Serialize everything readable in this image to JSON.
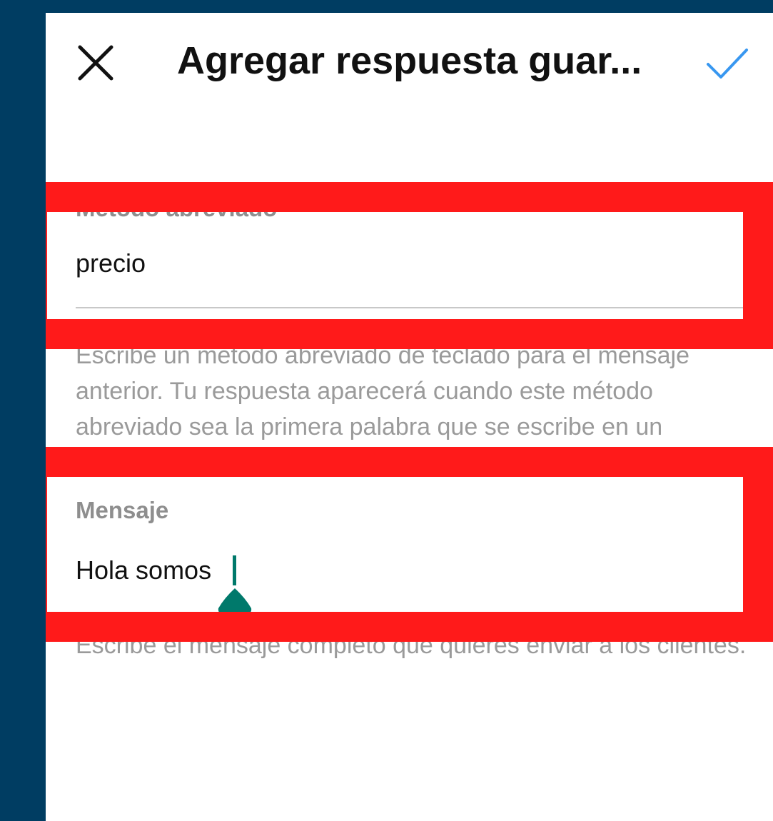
{
  "header": {
    "title": "Agregar respuesta guar...",
    "close_icon": "close-icon",
    "confirm_icon": "checkmark-icon",
    "accent_color": "#3897f0"
  },
  "shortcut_field": {
    "label": "Método abreviado",
    "value": "precio",
    "helper": "Escribe un método abreviado de teclado para el mensaje anterior. Tu respuesta aparecerá cuando este método abreviado sea la primera palabra que se escribe en un mensaje."
  },
  "message_field": {
    "label": "Mensaje",
    "value": "Hola somos",
    "helper": "Escribe el mensaje completo que quieres enviar a los clientes."
  },
  "colors": {
    "highlight": "#ff1a1a",
    "cursor": "#00796b",
    "frame": "#003d62"
  }
}
